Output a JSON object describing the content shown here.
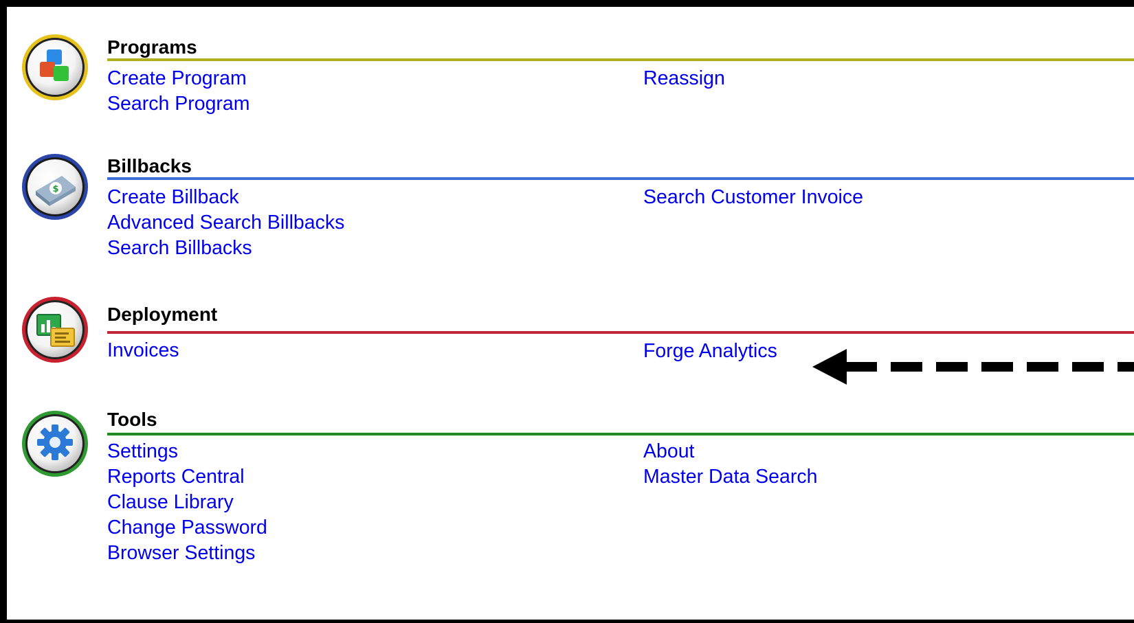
{
  "colors": {
    "programs_rule": "#b2b020",
    "billbacks_rule": "#3a6fd6",
    "deployment_rule": "#c0263a",
    "tools_rule": "#218a21",
    "link": "#0000ee"
  },
  "sections": [
    {
      "id": "programs",
      "title": "Programs",
      "icon": "cubes-icon",
      "left_links": [
        "Create Program",
        "Search Program"
      ],
      "right_links": [
        "Reassign"
      ]
    },
    {
      "id": "billbacks",
      "title": "Billbacks",
      "icon": "money-icon",
      "left_links": [
        "Create Billback",
        "Advanced Search Billbacks",
        "Search Billbacks"
      ],
      "right_links": [
        "Search Customer Invoice"
      ]
    },
    {
      "id": "deployment",
      "title": "Deployment",
      "icon": "deployment-chart-icon",
      "left_links": [
        "Invoices"
      ],
      "right_links": [
        "Forge Analytics"
      ]
    },
    {
      "id": "tools",
      "title": "Tools",
      "icon": "gear-icon",
      "left_links": [
        "Settings",
        "Reports Central",
        "Clause Library",
        "Change Password",
        "Browser Settings"
      ],
      "right_links": [
        "About",
        "Master Data Search"
      ]
    }
  ],
  "annotation": {
    "icon": "dashed-arrow-left-icon",
    "points_to": "Forge Analytics"
  }
}
